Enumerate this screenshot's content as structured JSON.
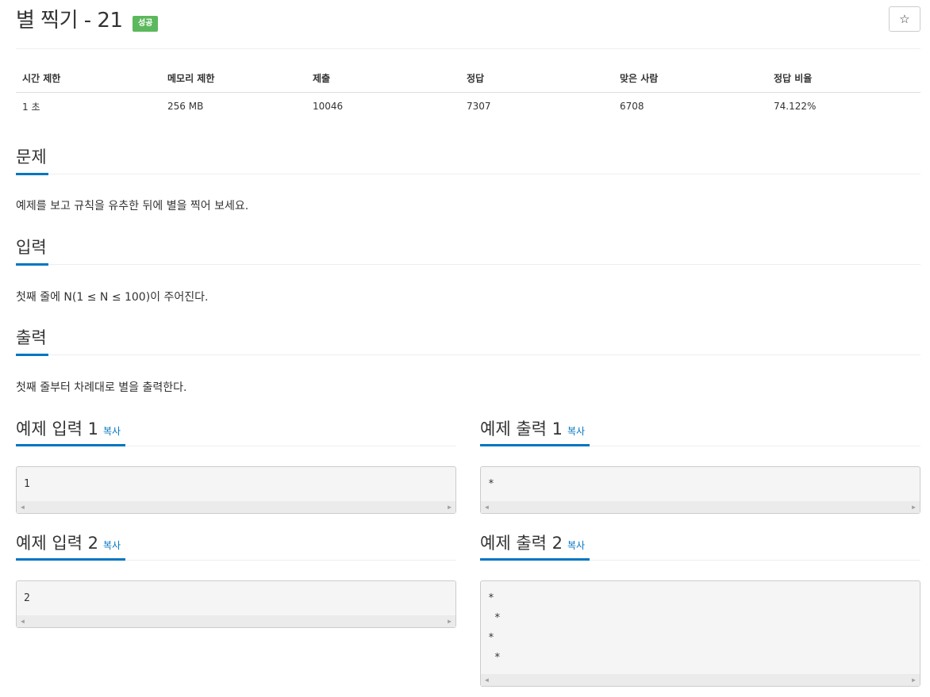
{
  "problem": {
    "title": "별 찍기 - 21",
    "badge": "성공",
    "star_icon": "☆"
  },
  "info_table": {
    "headers": [
      "시간 제한",
      "메모리 제한",
      "제출",
      "정답",
      "맞은 사람",
      "정답 비율"
    ],
    "values": [
      "1 초",
      "256 MB",
      "10046",
      "7307",
      "6708",
      "74.122%"
    ]
  },
  "sections": {
    "problem_heading": "문제",
    "problem_text": "예제를 보고 규칙을 유추한 뒤에 별을 찍어 보세요.",
    "input_heading": "입력",
    "input_text": "첫째 줄에 N(1 ≤ N ≤ 100)이 주어진다.",
    "output_heading": "출력",
    "output_text": "첫째 줄부터 차례대로 별을 출력한다."
  },
  "samples": {
    "copy_label": "복사",
    "input1_title": "예제 입력 1",
    "input1_lines": [
      "1"
    ],
    "output1_title": "예제 출력 1",
    "output1_lines": [
      "*"
    ],
    "input2_title": "예제 입력 2",
    "input2_lines": [
      "2"
    ],
    "output2_title": "예제 출력 2",
    "output2_lines": [
      "*",
      " *",
      "*",
      " *"
    ]
  },
  "colors": {
    "accent": "#0076c0",
    "badge_success": "#5cb85c"
  }
}
